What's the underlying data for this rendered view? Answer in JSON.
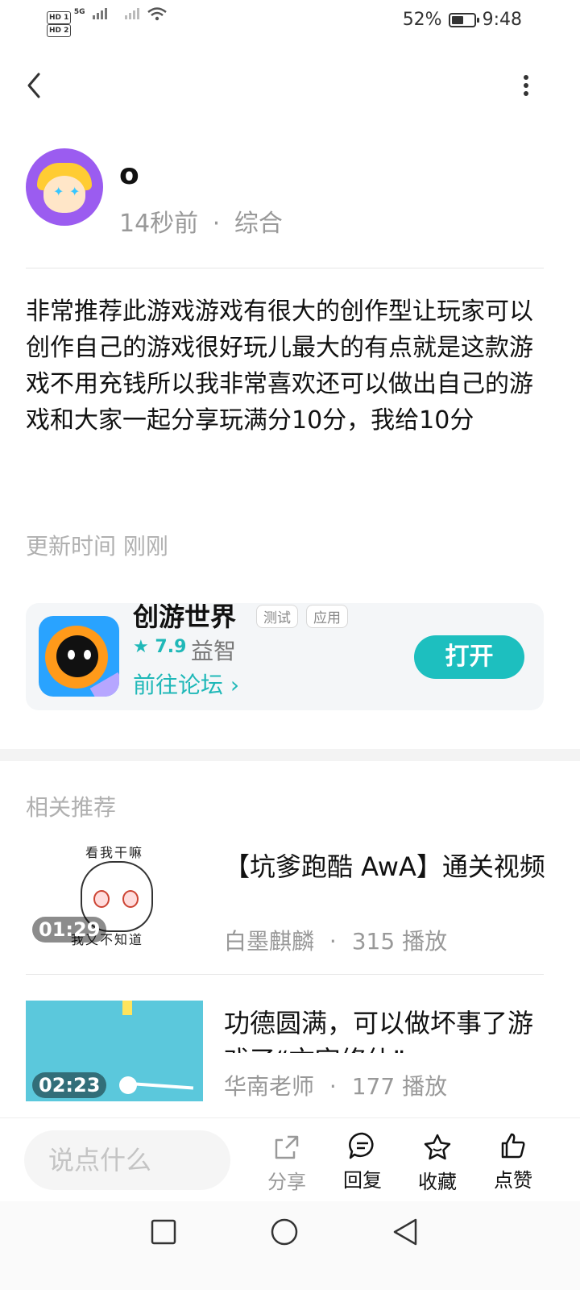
{
  "status_bar": {
    "sim1": "HD 1",
    "sim2": "HD 2",
    "network": "5G",
    "battery_text": "52%",
    "battery_level": 0.52,
    "time": "9:48"
  },
  "author": {
    "name": "o",
    "time_ago": "14秒前",
    "separator": "·",
    "category": "综合"
  },
  "post": {
    "text": "非常推荐此游戏游戏有很大的创作型让玩家可以创作自己的游戏很好玩儿最大的有点就是这款游戏不用充钱所以我非常喜欢还可以做出自己的游戏和大家一起分享玩满分10分，我给10分",
    "update_time": "更新时间 刚刚"
  },
  "game_card": {
    "title": "创游世界",
    "tags": [
      "测试",
      "应用"
    ],
    "rating": "7.9",
    "category": "益智",
    "forum_link": "前往论坛",
    "open_button": "打开",
    "accent_color": "#1dbfbf"
  },
  "related": {
    "section_title": "相关推荐",
    "items": [
      {
        "duration": "01:29",
        "thumb_text_top": "看我干嘛",
        "thumb_text_bottom": "我又不知道",
        "title": "【坑爹跑酷 AwA】通关视频",
        "author": "白墨麒麟",
        "separator": "·",
        "plays": "315 播放"
      },
      {
        "duration": "02:23",
        "title": "功德圆满，可以做坏事了游戏了“文字修仙”",
        "author": "华南老师",
        "separator": "·",
        "plays": "177 播放"
      }
    ]
  },
  "bottom_bar": {
    "comment_placeholder": "说点什么",
    "actions": {
      "share": "分享",
      "reply": "回复",
      "favorite": "收藏",
      "like": "点赞"
    }
  }
}
